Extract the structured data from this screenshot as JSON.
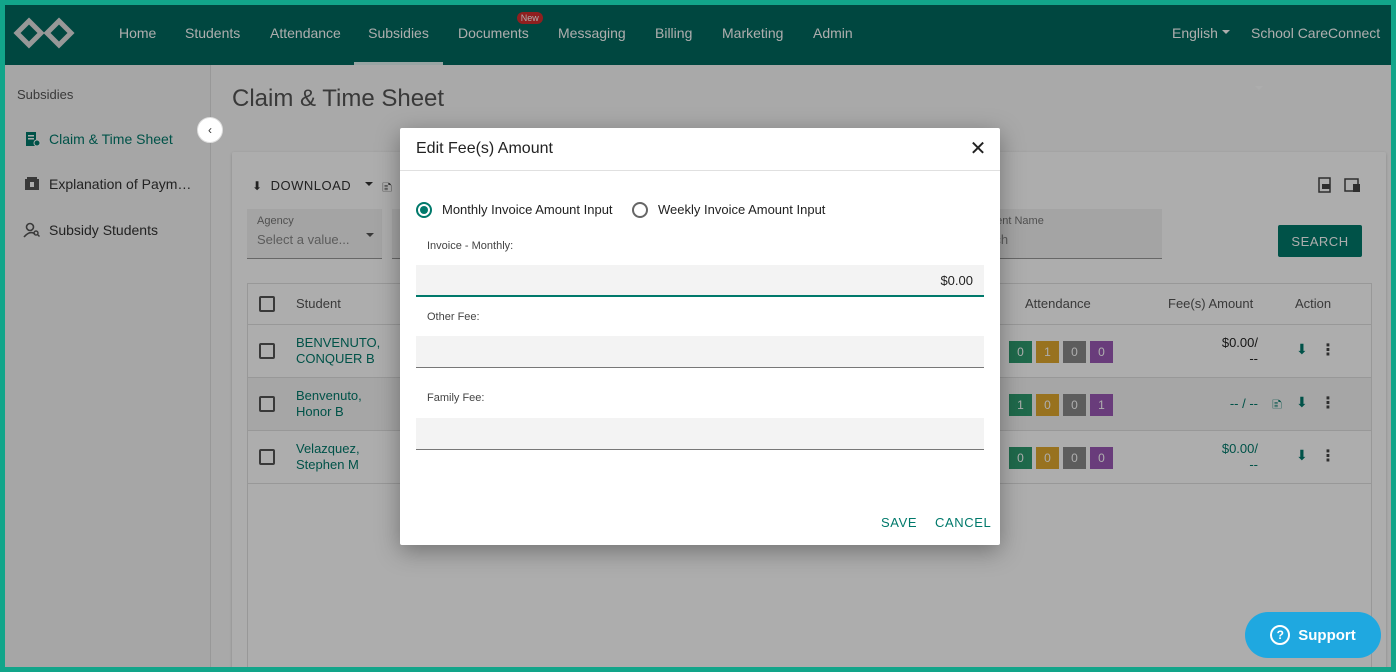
{
  "nav": {
    "items": [
      "Home",
      "Students",
      "Attendance",
      "Subsidies",
      "Documents",
      "Messaging",
      "Billing",
      "Marketing",
      "Admin"
    ],
    "new_badge": "New",
    "language": "English",
    "school": "School CareConnect"
  },
  "sidebar": {
    "title": "Subsidies",
    "items": [
      "Claim & Time Sheet",
      "Explanation of Paym…",
      "Subsidy Students"
    ]
  },
  "page": {
    "title": "Claim & Time Sheet",
    "download_label": "DOWNLOAD",
    "agency_label": "Agency",
    "agency_placeholder": "Select a value...",
    "student_name_label": "dent Name",
    "student_name_placeholder": "rch",
    "search_button": "SEARCH"
  },
  "table": {
    "headers": {
      "student": "Student",
      "attendance": "Attendance",
      "fee": "Fee(s) Amount",
      "action": "Action"
    },
    "rows": [
      {
        "name1": "BENVENUTO,",
        "name2": "CONQUER B",
        "att": [
          "0",
          "1",
          "0",
          "0"
        ],
        "fee1": "$0.00/",
        "fee2": "--"
      },
      {
        "name1": "Benvenuto,",
        "name2": "Honor B",
        "att": [
          "1",
          "0",
          "0",
          "1"
        ],
        "fee1": "-- / --",
        "fee2": ""
      },
      {
        "name1": "Velazquez,",
        "name2": "Stephen M",
        "att": [
          "0",
          "0",
          "0",
          "0"
        ],
        "fee1": "$0.00/",
        "fee2": "--"
      }
    ]
  },
  "dialog": {
    "title": "Edit Fee(s) Amount",
    "close": "✕",
    "radio_monthly": "Monthly Invoice Amount Input",
    "radio_weekly": "Weekly Invoice Amount Input",
    "invoice_monthly_label": "Invoice - Monthly:",
    "invoice_monthly_value": "$0.00",
    "other_fee_label": "Other Fee:",
    "other_fee_value": "",
    "family_fee_label": "Family Fee:",
    "family_fee_value": "",
    "save": "SAVE",
    "cancel": "CANCEL"
  },
  "support": {
    "label": "Support",
    "icon_glyph": "?"
  },
  "colors": {
    "brand": "#00695f",
    "accent": "#00796b",
    "support": "#1fa8e0"
  }
}
